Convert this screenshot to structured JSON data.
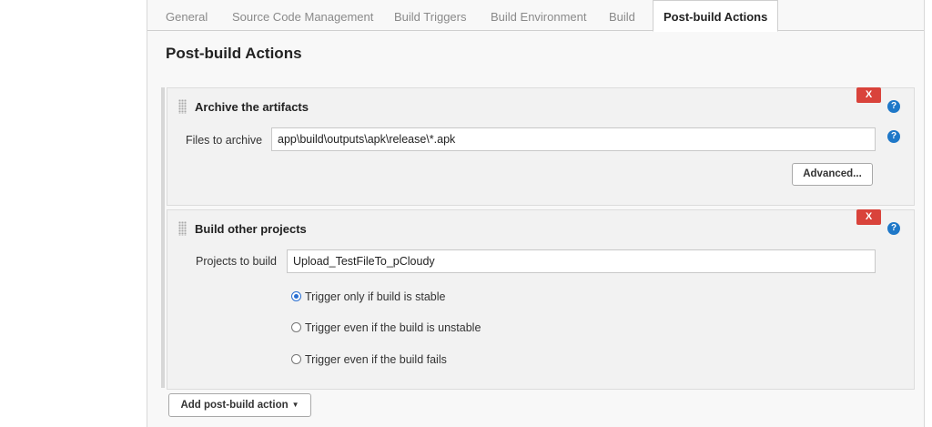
{
  "tabs": [
    {
      "label": "General",
      "active": false
    },
    {
      "label": "Source Code Management",
      "active": false
    },
    {
      "label": "Build Triggers",
      "active": false
    },
    {
      "label": "Build Environment",
      "active": false
    },
    {
      "label": "Build",
      "active": false
    },
    {
      "label": "Post-build Actions",
      "active": true
    }
  ],
  "section_title": "Post-build Actions",
  "archive": {
    "title": "Archive the artifacts",
    "delete_label": "X",
    "help_label": "?",
    "files_label": "Files to archive",
    "files_value": "app\\build\\outputs\\apk\\release\\*.apk",
    "advanced_label": "Advanced..."
  },
  "build_other": {
    "title": "Build other projects",
    "delete_label": "X",
    "help_label": "?",
    "projects_label": "Projects to build",
    "projects_value": "Upload_TestFileTo_pCloudy",
    "options": [
      {
        "label": "Trigger only if build is stable",
        "selected": true
      },
      {
        "label": "Trigger even if the build is unstable",
        "selected": false
      },
      {
        "label": "Trigger even if the build fails",
        "selected": false
      }
    ]
  },
  "add_action_label": "Add post-build action",
  "colors": {
    "delete_red": "#d9433b",
    "help_blue": "#1f78c8",
    "radio_blue": "#2a6fd1"
  }
}
